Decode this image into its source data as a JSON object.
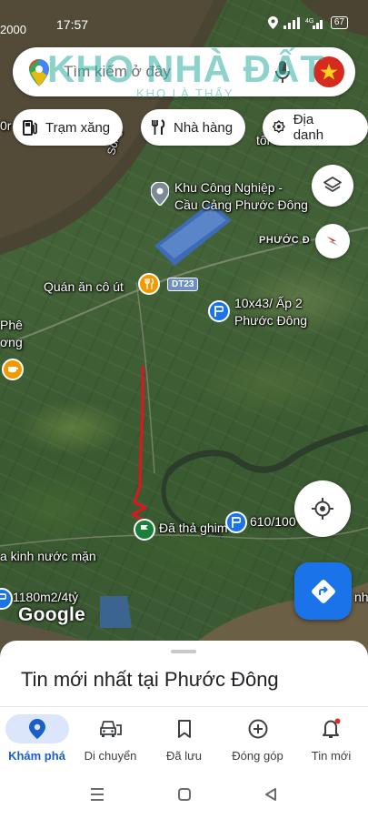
{
  "status_bar": {
    "time": "17:57",
    "left_text": "2000",
    "battery": "67"
  },
  "search": {
    "placeholder": "Tìm kiếm ở đây"
  },
  "watermark": {
    "main": "KHO NHÀ ĐẤT",
    "sub": "KHO LÀ THẤY"
  },
  "chips": [
    {
      "label": "Trạm xăng",
      "icon": "gas-station-icon"
    },
    {
      "label": "Nhà hàng",
      "icon": "restaurant-icon"
    },
    {
      "label": "Địa danh",
      "icon": "landmark-icon"
    }
  ],
  "map_labels": {
    "industrial_zone_1": "Khu Công Nghiệp -",
    "industrial_zone_2": "Cầu Cảng Phước Đông",
    "area_label": "PHƯỚC Đ",
    "restaurant": "Quán ăn cô út",
    "road": "DT23",
    "listing_1_line1": "10x43/ Ấp 2",
    "listing_1_line2": "Phước Đông",
    "pin_dropped": "Đã thả ghim",
    "listing_2": "610/100",
    "listing_3": "1180m2/4tỷ",
    "left_1": "Phê",
    "left_2": "ơng",
    "left_3": "a kinh nước mặn",
    "river_label": "Sông",
    "top_left_edge": "0r",
    "top_right_edge": "tổi tâ",
    "right_edge": "nh"
  },
  "google_logo": "Google",
  "sheet": {
    "title": "Tin mới nhất tại Phước Đông"
  },
  "nav": [
    {
      "label": "Khám phá",
      "icon": "explore-pin-icon",
      "active": true
    },
    {
      "label": "Di chuyển",
      "icon": "car-icon",
      "active": false
    },
    {
      "label": "Đã lưu",
      "icon": "bookmark-icon",
      "active": false
    },
    {
      "label": "Đóng góp",
      "icon": "plus-circle-icon",
      "active": false
    },
    {
      "label": "Tin mới",
      "icon": "bell-icon",
      "active": false
    }
  ],
  "colors": {
    "accent": "#1a73e8",
    "pin_green": "#188038",
    "pin_blue": "#1a73e8",
    "food_orange": "#f29900"
  }
}
